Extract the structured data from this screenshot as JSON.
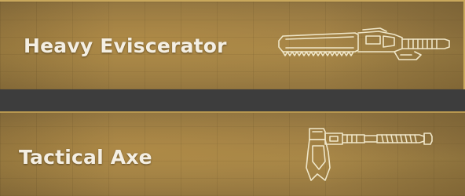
{
  "items": [
    {
      "name": "Heavy Eviscerator",
      "icon": "chainsword-icon"
    },
    {
      "name": "Tactical Axe",
      "icon": "axe-icon"
    }
  ],
  "colors": {
    "card_background": "#9c7d45",
    "card_border": "#c9a85c",
    "icon_outline": "#efe6c8",
    "label_text": "#f4efe3",
    "separator": "#3d3d3d"
  }
}
